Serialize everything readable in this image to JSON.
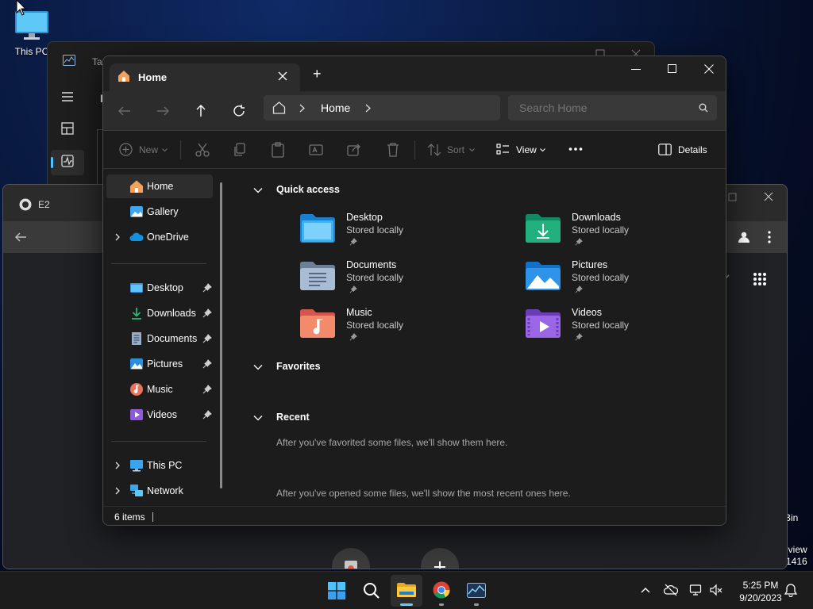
{
  "desktop": {
    "this_pc_label": "This PC",
    "recycle_bin_label": "Bin",
    "watermark_line1": "eview",
    "watermark_line2": "-1416"
  },
  "taskmgr_bg": {
    "title_partial": "Tas",
    "heading_partial": "F"
  },
  "chrome_bg": {
    "tab_partial": "E2"
  },
  "explorer": {
    "tab_title": "Home",
    "new_tab_label": "+",
    "breadcrumb": [
      "Home"
    ],
    "search_placeholder": "Search Home",
    "commands": {
      "new": "New",
      "sort": "Sort",
      "view": "View",
      "details": "Details"
    },
    "nav": {
      "home": "Home",
      "gallery": "Gallery",
      "onedrive": "OneDrive",
      "pinned": [
        {
          "label": "Desktop",
          "icon": "desktop-folder-icon"
        },
        {
          "label": "Downloads",
          "icon": "downloads-icon"
        },
        {
          "label": "Documents",
          "icon": "documents-icon"
        },
        {
          "label": "Pictures",
          "icon": "pictures-icon"
        },
        {
          "label": "Music",
          "icon": "music-icon"
        },
        {
          "label": "Videos",
          "icon": "videos-icon"
        }
      ],
      "this_pc": "This PC",
      "network": "Network"
    },
    "sections": {
      "quick_access": "Quick access",
      "favorites": "Favorites",
      "favorites_empty": "After you've favorited some files, we'll show them here.",
      "recent": "Recent",
      "recent_empty": "After you've opened some files, we'll show the most recent ones here."
    },
    "quick_access": [
      {
        "name": "Desktop",
        "status": "Stored locally"
      },
      {
        "name": "Downloads",
        "status": "Stored locally"
      },
      {
        "name": "Documents",
        "status": "Stored locally"
      },
      {
        "name": "Pictures",
        "status": "Stored locally"
      },
      {
        "name": "Music",
        "status": "Stored locally"
      },
      {
        "name": "Videos",
        "status": "Stored locally"
      }
    ],
    "status_bar": {
      "item_count": "6 items"
    }
  },
  "taskbar": {
    "time": "5:25 PM",
    "date": "9/20/2023",
    "apps": [
      "start-icon",
      "search-icon",
      "file-explorer-icon",
      "chrome-icon",
      "task-manager-icon"
    ]
  },
  "colors": {
    "accent": "#60cdff",
    "folder_yellow": "#f5c542",
    "desktop_bg": "#0a1c45"
  }
}
